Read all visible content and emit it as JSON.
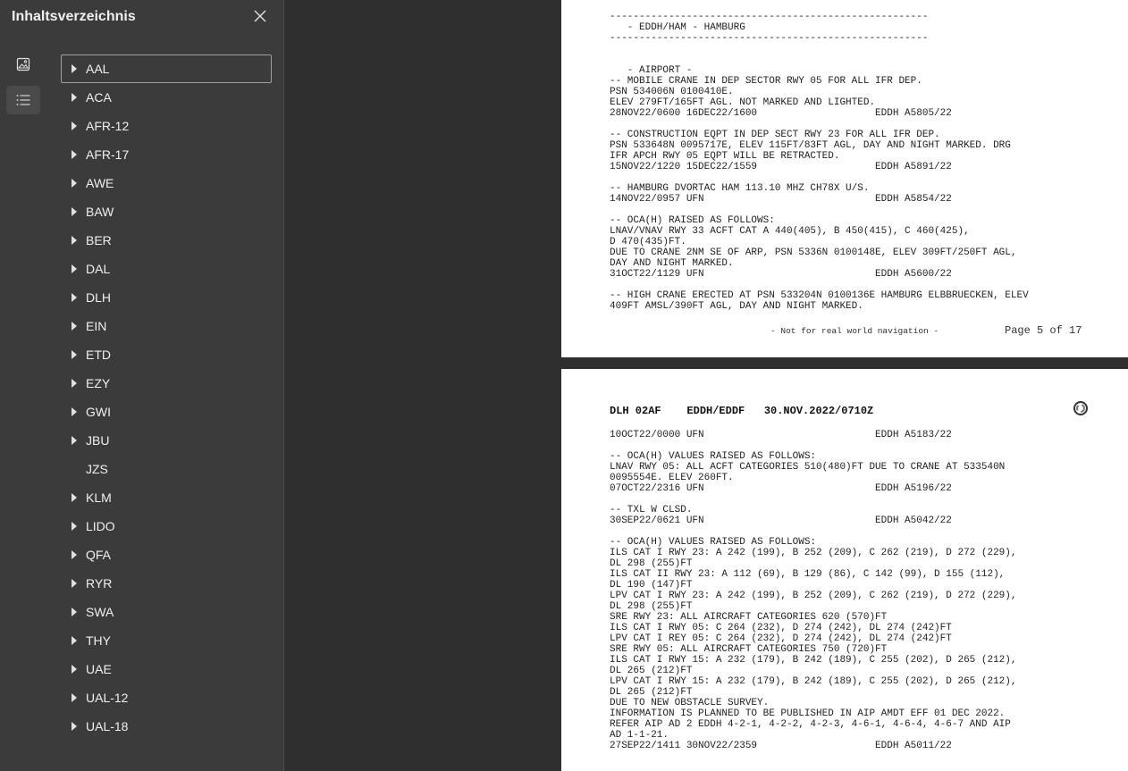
{
  "sidebar": {
    "title": "Inhaltsverzeichnis",
    "close_icon": "close-icon",
    "rail": [
      {
        "name": "thumbnails",
        "icon": "image-icon",
        "active": false
      },
      {
        "name": "outline",
        "icon": "list-icon",
        "active": true
      }
    ],
    "toc": [
      {
        "label": "AAL",
        "expandable": true,
        "selected": true
      },
      {
        "label": "ACA",
        "expandable": true
      },
      {
        "label": "AFR-12",
        "expandable": true
      },
      {
        "label": "AFR-17",
        "expandable": true
      },
      {
        "label": "AWE",
        "expandable": true
      },
      {
        "label": "BAW",
        "expandable": true
      },
      {
        "label": "BER",
        "expandable": true
      },
      {
        "label": "DAL",
        "expandable": true
      },
      {
        "label": "DLH",
        "expandable": true
      },
      {
        "label": "EIN",
        "expandable": true
      },
      {
        "label": "ETD",
        "expandable": true
      },
      {
        "label": "EZY",
        "expandable": true
      },
      {
        "label": "GWI",
        "expandable": true
      },
      {
        "label": "JBU",
        "expandable": true
      },
      {
        "label": "JZS",
        "expandable": false
      },
      {
        "label": "KLM",
        "expandable": true
      },
      {
        "label": "LIDO",
        "expandable": true
      },
      {
        "label": "QFA",
        "expandable": true
      },
      {
        "label": "RYR",
        "expandable": true
      },
      {
        "label": "SWA",
        "expandable": true
      },
      {
        "label": "THY",
        "expandable": true
      },
      {
        "label": "UAE",
        "expandable": true
      },
      {
        "label": "UAL-12",
        "expandable": true
      },
      {
        "label": "UAL-18",
        "expandable": true
      }
    ]
  },
  "page1": {
    "lines": [
      "------------------------------------------------------",
      "   - EDDH/HAM - HAMBURG",
      "------------------------------------------------------",
      "",
      "",
      "   - AIRPORT -",
      "-- MOBILE CRANE IN DEP SECTOR RWY 05 FOR ALL IFR DEP.",
      "PSN 534006N 0100410E.",
      "ELEV 279FT/165FT AGL. NOT MARKED AND LIGHTED.",
      "28NOV22/0600 16DEC22/1600                    EDDH A5805/22",
      "",
      "-- CONSTRUCTION EQPT IN DEP SECT RWY 23 FOR ALL IFR DEP.",
      "PSN 533648N 0095717E, ELEV 115FT/83FT AGL, DAY AND NIGHT MARKED. DRG",
      "IFR APCH RWY 05 EQPT WILL BE RETRACTED.",
      "15NOV22/1220 15DEC22/1559                    EDDH A5891/22",
      "",
      "-- HAMBURG DVORTAC HAM 113.10 MHZ CH78X U/S.",
      "14NOV22/0957 UFN                             EDDH A5854/22",
      "",
      "-- OCA(H) RAISED AS FOLLOWS:",
      "LNAV/VNAV RWY 33 ACFT CAT A 440(405), B 450(415), C 460(425),",
      "D 470(435)FT.",
      "DUE TO CRANE 2NM SE OF ARP, PSN 5336N 0100148E, ELEV 309FT/250FT AGL,",
      "DAY AND NIGHT MARKED.",
      "31OCT22/1129 UFN                             EDDH A5600/22",
      "",
      "-- HIGH CRANE ERECTED AT PSN 533204N 0100136E HAMBURG ELBBRUECKEN, ELEV",
      "409FT AMSL/390FT AGL, DAY AND NIGHT MARKED."
    ],
    "footer_note": "- Not for real world navigation -",
    "footer_page": "Page 5 of 17"
  },
  "page2": {
    "header": "DLH 02AF    EDDH/EDDF   30.NOV.2022/0710Z",
    "lines": [
      "10OCT22/0000 UFN                             EDDH A5183/22",
      "",
      "-- OCA(H) VALUES RAISED AS FOLLOWS:",
      "LNAV RWY 05: ALL ACFT CATEGORIES 510(480)FT DUE TO CRANE AT 533540N",
      "0095554E. ELEV 260FT.",
      "07OCT22/2316 UFN                             EDDH A5196/22",
      "",
      "-- TXL W CLSD.",
      "30SEP22/0621 UFN                             EDDH A5042/22",
      "",
      "-- OCA(H) VALUES RAISED AS FOLLOWS:",
      "ILS CAT I RWY 23: A 242 (199), B 252 (209), C 262 (219), D 272 (229),",
      "DL 298 (255)FT",
      "ILS CAT II RWY 23: A 112 (69), B 129 (86), C 142 (99), D 155 (112),",
      "DL 190 (147)FT",
      "LPV CAT I RWY 23: A 242 (199), B 252 (209), C 262 (219), D 272 (229),",
      "DL 298 (255)FT",
      "SRE RWY 23: ALL AIRCRAFT CATEGORIES 620 (570)FT",
      "ILS CAT I RWY 05: C 264 (232), D 274 (242), DL 274 (242)FT",
      "LPV CAT I REY 05: C 264 (232), D 274 (242), DL 274 (242)FT",
      "SRE RWY 05: ALL AIRCRAFT CATEGORIES 750 (720)FT",
      "ILS CAT I RWY 15: A 232 (179), B 242 (189), C 255 (202), D 265 (212),",
      "DL 265 (212)FT",
      "LPV CAT I RWY 15: A 232 (179), B 242 (189), C 255 (202), D 265 (212),",
      "DL 265 (212)FT",
      "DUE TO NEW OBSTACLE SURVEY.",
      "INFORMATION IS PLANNED TO BE PUBLISHED IN AIP AMDT EFF 01 DEC 2022.",
      "REFER AIP AD 2 EDDH 4-2-1, 4-2-2, 4-2-3, 4-6-1, 4-6-4, 4-6-7 AND AIP",
      "AD 1-1-21.",
      "27SEP22/1411 30NOV22/2359                    EDDH A5011/22"
    ],
    "icon": "loading-spinner-icon"
  }
}
